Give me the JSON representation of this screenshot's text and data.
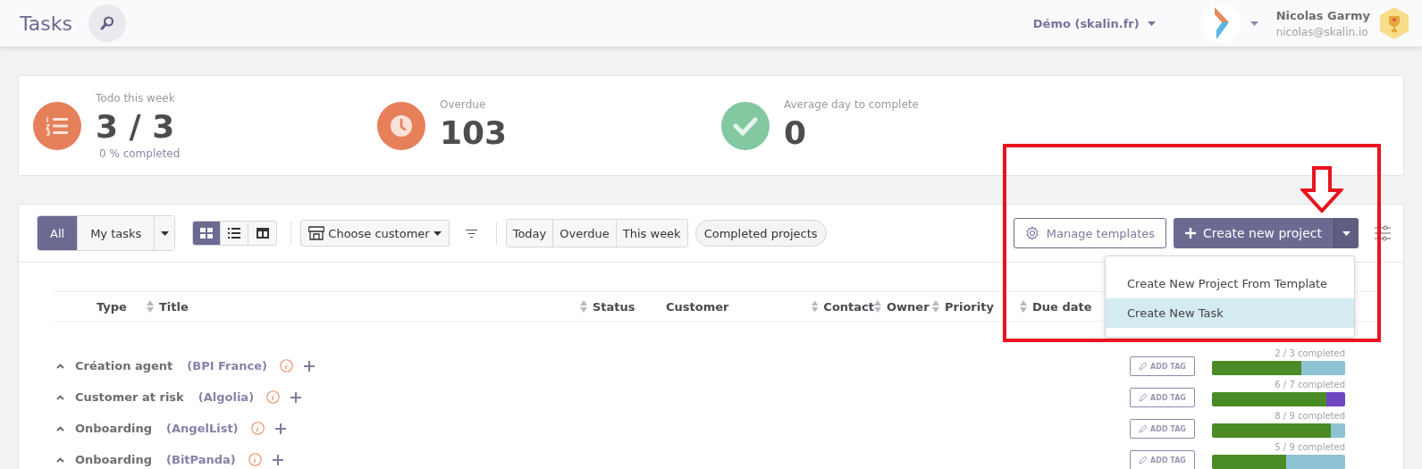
{
  "header": {
    "title": "Tasks",
    "workspace": "Démo (skalin.fr)",
    "user_name": "Nicolas Garmy",
    "user_email": "nicolas@skalin.io"
  },
  "stats": [
    {
      "kind": "todo",
      "label": "Todo this week",
      "value": "3 / 3",
      "note": "0 % completed",
      "color": "#e5805a"
    },
    {
      "kind": "overdue",
      "label": "Overdue",
      "value": "103",
      "color": "#e5805a"
    },
    {
      "kind": "average",
      "label": "Average day to complete",
      "value": "0",
      "color": "#82c8a0"
    }
  ],
  "toolbar": {
    "scope_tabs": [
      {
        "label": "All",
        "selected": true
      },
      {
        "label": "My tasks",
        "selected": false
      }
    ],
    "views": [
      {
        "kind": "grid",
        "selected": true
      },
      {
        "kind": "list",
        "selected": false
      },
      {
        "kind": "columns",
        "selected": false
      }
    ],
    "customer_filter": "Choose customer",
    "date_filters": [
      "Today",
      "Overdue",
      "This week"
    ],
    "completed_filter": "Completed projects",
    "manage_templates": "Manage templates",
    "create_button": "Create new project"
  },
  "create_menu": {
    "items": [
      {
        "label": "Create New Project From Template",
        "selected": false
      },
      {
        "label": "Create New Task",
        "selected": true
      }
    ]
  },
  "table": {
    "columns": [
      {
        "label": "Type",
        "sortable": false
      },
      {
        "label": "Title",
        "sortable": true
      },
      {
        "label": "Status",
        "sortable": true
      },
      {
        "label": "Customer",
        "sortable": false
      },
      {
        "label": "Contact",
        "sortable": true
      },
      {
        "label": "Owner",
        "sortable": true
      },
      {
        "label": "Priority",
        "sortable": true
      },
      {
        "label": "Due date",
        "sortable": true
      }
    ],
    "rows": [
      {
        "title": "Création agent",
        "customer": "(BPI France)",
        "tag_button": "ADD TAG",
        "progress_text": "2 / 3 completed",
        "level": 0.67,
        "color": "#8ec3d3"
      },
      {
        "title": "Customer at risk",
        "customer": "(Algolia)",
        "tag_button": "ADD TAG",
        "progress_text": "6 / 7 completed",
        "level": 0.86,
        "color": "#6e46bf"
      },
      {
        "title": "Onboarding",
        "customer": "(AngelList)",
        "tag_button": "ADD TAG",
        "progress_text": "8 / 9 completed",
        "level": 0.89,
        "color": "#8ec3d3"
      },
      {
        "title": "Onboarding",
        "customer": "(BitPanda)",
        "tag_button": "ADD TAG",
        "progress_text": "5 / 9 completed",
        "level": 0.56,
        "color": "#8ec3d3"
      }
    ]
  }
}
